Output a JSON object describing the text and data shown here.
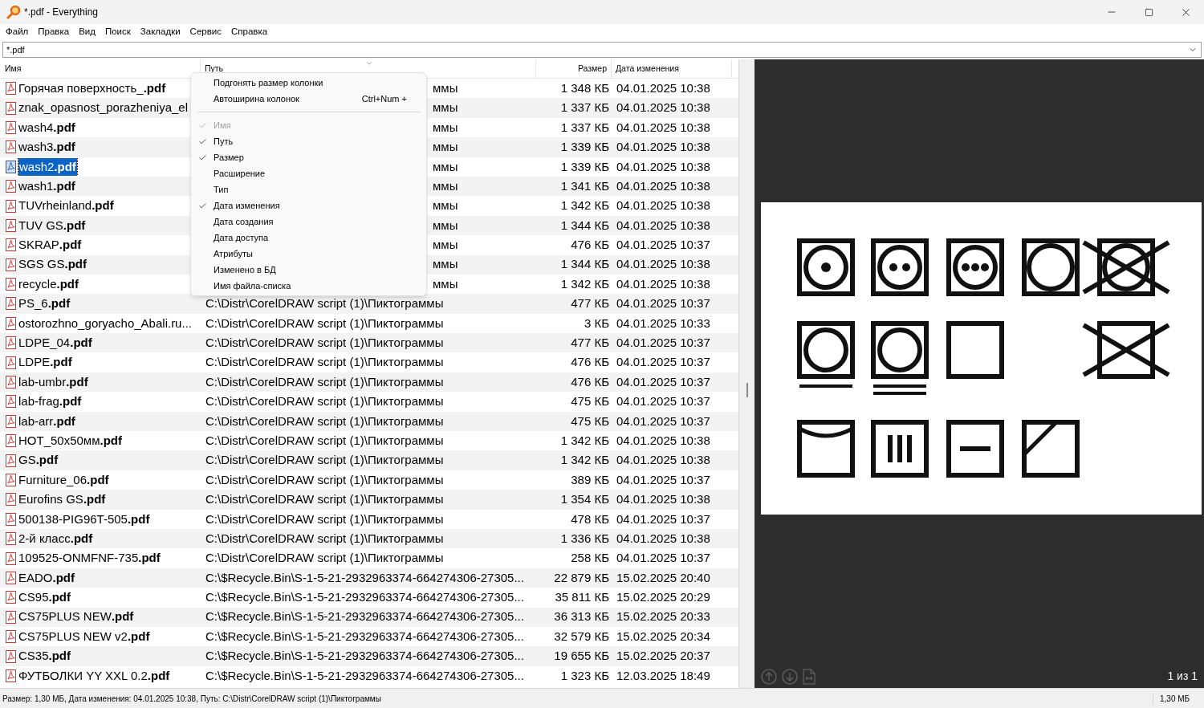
{
  "window": {
    "title": "*.pdf - Everything"
  },
  "menu_bar": [
    "Файл",
    "Правка",
    "Вид",
    "Поиск",
    "Закладки",
    "Сервис",
    "Справка"
  ],
  "search": {
    "value": "*.pdf"
  },
  "table": {
    "columns": [
      "Имя",
      "Путь",
      "Размер",
      "Дата изменения"
    ],
    "rows": [
      {
        "name": "Горячая поверхность_**.pdf**",
        "path": "ммы",
        "path_covered": true,
        "size": "1 348 КБ",
        "date": "04.01.2025 10:38",
        "selected": false
      },
      {
        "name": "znak_opasnost_porazheniya_el",
        "path": "ммы",
        "path_covered": true,
        "size": "1 337 КБ",
        "date": "04.01.2025 10:38",
        "selected": false
      },
      {
        "name": "wash4**.pdf**",
        "path": "ммы",
        "path_covered": true,
        "size": "1 337 КБ",
        "date": "04.01.2025 10:38",
        "selected": false
      },
      {
        "name": "wash3**.pdf**",
        "path": "ммы",
        "path_covered": true,
        "size": "1 339 КБ",
        "date": "04.01.2025 10:38",
        "selected": false
      },
      {
        "name": "wash2**.pdf**",
        "path": "ммы",
        "path_covered": true,
        "size": "1 339 КБ",
        "date": "04.01.2025 10:38",
        "selected": true
      },
      {
        "name": "wash1**.pdf**",
        "path": "ммы",
        "path_covered": true,
        "size": "1 341 КБ",
        "date": "04.01.2025 10:38",
        "selected": false
      },
      {
        "name": "TUVrheinland**.pdf**",
        "path": "ммы",
        "path_covered": true,
        "size": "1 342 КБ",
        "date": "04.01.2025 10:38",
        "selected": false
      },
      {
        "name": "TUV GS**.pdf**",
        "path": "ммы",
        "path_covered": true,
        "size": "1 344 КБ",
        "date": "04.01.2025 10:38",
        "selected": false
      },
      {
        "name": "SKRAP**.pdf**",
        "path": "ммы",
        "path_covered": true,
        "size": "476 КБ",
        "date": "04.01.2025 10:37",
        "selected": false
      },
      {
        "name": "SGS GS**.pdf**",
        "path": "ммы",
        "path_covered": true,
        "size": "1 344 КБ",
        "date": "04.01.2025 10:38",
        "selected": false
      },
      {
        "name": "recycle**.pdf**",
        "path": "ммы",
        "path_covered": true,
        "size": "1 342 КБ",
        "date": "04.01.2025 10:38",
        "selected": false
      },
      {
        "name": "PS_6**.pdf**",
        "path": "C:\\Distr\\CorelDRAW script (1)\\Пиктограммы",
        "path_covered": false,
        "size": "477 КБ",
        "date": "04.01.2025 10:37",
        "selected": false
      },
      {
        "name": "ostorozhno_goryacho_Abali.ru...",
        "path": "C:\\Distr\\CorelDRAW script (1)\\Пиктограммы",
        "path_covered": false,
        "size": "3 КБ",
        "date": "04.01.2025 10:33",
        "selected": false
      },
      {
        "name": "LDPE_04**.pdf**",
        "path": "C:\\Distr\\CorelDRAW script (1)\\Пиктограммы",
        "path_covered": false,
        "size": "477 КБ",
        "date": "04.01.2025 10:37",
        "selected": false
      },
      {
        "name": "LDPE**.pdf**",
        "path": "C:\\Distr\\CorelDRAW script (1)\\Пиктограммы",
        "path_covered": false,
        "size": "476 КБ",
        "date": "04.01.2025 10:37",
        "selected": false
      },
      {
        "name": "lab-umbr**.pdf**",
        "path": "C:\\Distr\\CorelDRAW script (1)\\Пиктограммы",
        "path_covered": false,
        "size": "476 КБ",
        "date": "04.01.2025 10:37",
        "selected": false
      },
      {
        "name": "lab-frag**.pdf**",
        "path": "C:\\Distr\\CorelDRAW script (1)\\Пиктограммы",
        "path_covered": false,
        "size": "475 КБ",
        "date": "04.01.2025 10:37",
        "selected": false
      },
      {
        "name": "lab-arr**.pdf**",
        "path": "C:\\Distr\\CorelDRAW script (1)\\Пиктограммы",
        "path_covered": false,
        "size": "475 КБ",
        "date": "04.01.2025 10:37",
        "selected": false
      },
      {
        "name": "HOT_50x50мм**.pdf**",
        "path": "C:\\Distr\\CorelDRAW script (1)\\Пиктограммы",
        "path_covered": false,
        "size": "1 342 КБ",
        "date": "04.01.2025 10:38",
        "selected": false
      },
      {
        "name": "GS**.pdf**",
        "path": "C:\\Distr\\CorelDRAW script (1)\\Пиктограммы",
        "path_covered": false,
        "size": "1 342 КБ",
        "date": "04.01.2025 10:38",
        "selected": false
      },
      {
        "name": "Furniture_06**.pdf**",
        "path": "C:\\Distr\\CorelDRAW script (1)\\Пиктограммы",
        "path_covered": false,
        "size": "389 КБ",
        "date": "04.01.2025 10:37",
        "selected": false
      },
      {
        "name": "Eurofins GS**.pdf**",
        "path": "C:\\Distr\\CorelDRAW script (1)\\Пиктограммы",
        "path_covered": false,
        "size": "1 354 КБ",
        "date": "04.01.2025 10:38",
        "selected": false
      },
      {
        "name": "500138-PIG96T-505**.pdf**",
        "path": "C:\\Distr\\CorelDRAW script (1)\\Пиктограммы",
        "path_covered": false,
        "size": "478 КБ",
        "date": "04.01.2025 10:37",
        "selected": false
      },
      {
        "name": "2-й класс**.pdf**",
        "path": "C:\\Distr\\CorelDRAW script (1)\\Пиктограммы",
        "path_covered": false,
        "size": "1 336 КБ",
        "date": "04.01.2025 10:38",
        "selected": false
      },
      {
        "name": "109525-ONMFNF-735**.pdf**",
        "path": "C:\\Distr\\CorelDRAW script (1)\\Пиктограммы",
        "path_covered": false,
        "size": "258 КБ",
        "date": "04.01.2025 10:37",
        "selected": false
      },
      {
        "name": "EADO**.pdf**",
        "path": "C:\\$Recycle.Bin\\S-1-5-21-2932963374-664274306-27305...",
        "path_covered": false,
        "size": "22 879 КБ",
        "date": "15.02.2025 20:40",
        "selected": false
      },
      {
        "name": "CS95**.pdf**",
        "path": "C:\\$Recycle.Bin\\S-1-5-21-2932963374-664274306-27305...",
        "path_covered": false,
        "size": "35 811 КБ",
        "date": "15.02.2025 20:29",
        "selected": false
      },
      {
        "name": "CS75PLUS NEW**.pdf**",
        "path": "C:\\$Recycle.Bin\\S-1-5-21-2932963374-664274306-27305...",
        "path_covered": false,
        "size": "36 313 КБ",
        "date": "15.02.2025 20:33",
        "selected": false
      },
      {
        "name": "CS75PLUS NEW v2**.pdf**",
        "path": "C:\\$Recycle.Bin\\S-1-5-21-2932963374-664274306-27305...",
        "path_covered": false,
        "size": "32 579 КБ",
        "date": "15.02.2025 20:34",
        "selected": false
      },
      {
        "name": "CS35**.pdf**",
        "path": "C:\\$Recycle.Bin\\S-1-5-21-2932963374-664274306-27305...",
        "path_covered": false,
        "size": "19 655 КБ",
        "date": "15.02.2025 20:37",
        "selected": false
      },
      {
        "name": "ФУТБОЛКИ YY XXL 0.2**.pdf**",
        "path": "C:\\$Recycle.Bin\\S-1-5-21-2932963374-664274306-27305...",
        "path_covered": false,
        "size": "1 323 КБ",
        "date": "12.03.2025 18:49",
        "selected": false
      }
    ]
  },
  "context_menu": {
    "actions": [
      {
        "label": "Подгонять размер колонки"
      },
      {
        "label": "Автоширина колонок",
        "shortcut": "Ctrl+Num +"
      }
    ],
    "columns": [
      {
        "label": "Имя",
        "checked": true,
        "disabled": true
      },
      {
        "label": "Путь",
        "checked": true,
        "disabled": false
      },
      {
        "label": "Размер",
        "checked": true,
        "disabled": false
      },
      {
        "label": "Расширение",
        "checked": false,
        "disabled": false
      },
      {
        "label": "Тип",
        "checked": false,
        "disabled": false
      },
      {
        "label": "Дата изменения",
        "checked": true,
        "disabled": false
      },
      {
        "label": "Дата создания",
        "checked": false,
        "disabled": false
      },
      {
        "label": "Дата доступа",
        "checked": false,
        "disabled": false
      },
      {
        "label": "Атрибуты",
        "checked": false,
        "disabled": false
      },
      {
        "label": "Изменено в БД",
        "checked": false,
        "disabled": false
      },
      {
        "label": "Имя файла-списка",
        "checked": false,
        "disabled": false
      }
    ]
  },
  "preview": {
    "page_count": "1 из 1"
  },
  "status_bar": {
    "text": "Размер: 1,30 МБ, Дата изменения: 04.01.2025 10:38, Путь: C:\\Distr\\CorelDRAW script (1)\\Пиктограммы",
    "total": "1,30 МБ"
  }
}
